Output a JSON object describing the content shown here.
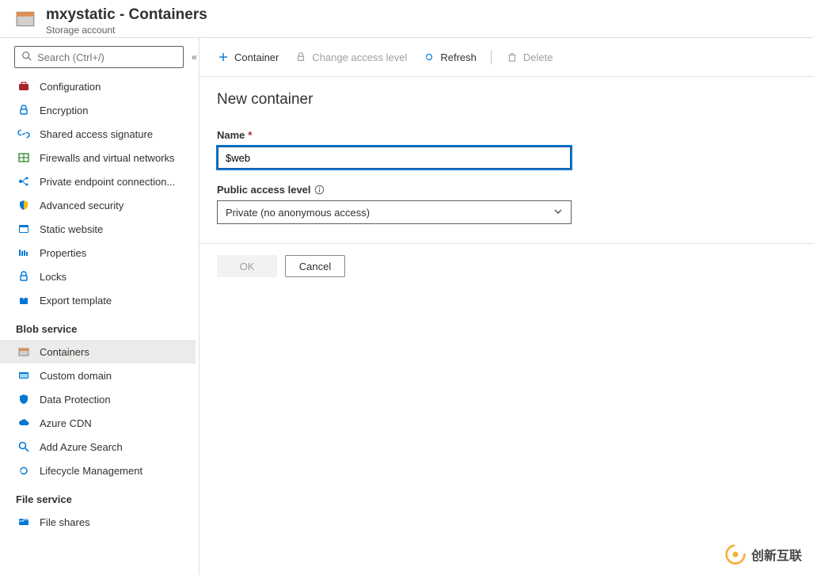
{
  "header": {
    "title": "mxystatic - Containers",
    "subtitle": "Storage account"
  },
  "search": {
    "placeholder": "Search (Ctrl+/)"
  },
  "sidebar": {
    "items_top": [
      {
        "label": "Configuration",
        "icon": "briefcase",
        "color": "#a4262c"
      },
      {
        "label": "Encryption",
        "icon": "lock",
        "color": "#0078d4"
      },
      {
        "label": "Shared access signature",
        "icon": "link",
        "color": "#0078d4"
      },
      {
        "label": "Firewalls and virtual networks",
        "icon": "firewall",
        "color": "#107c10"
      },
      {
        "label": "Private endpoint connection...",
        "icon": "endpoint",
        "color": "#0078d4"
      },
      {
        "label": "Advanced security",
        "icon": "shield",
        "color": "#0078d4"
      },
      {
        "label": "Static website",
        "icon": "website",
        "color": "#0078d4"
      },
      {
        "label": "Properties",
        "icon": "properties",
        "color": "#0078d4"
      },
      {
        "label": "Locks",
        "icon": "lock",
        "color": "#0078d4"
      },
      {
        "label": "Export template",
        "icon": "export",
        "color": "#0078d4"
      }
    ],
    "section_blob": "Blob service",
    "items_blob": [
      {
        "label": "Containers",
        "icon": "container",
        "color": "#0078d4",
        "active": true
      },
      {
        "label": "Custom domain",
        "icon": "domain",
        "color": "#0078d4"
      },
      {
        "label": "Data Protection",
        "icon": "protection",
        "color": "#0078d4"
      },
      {
        "label": "Azure CDN",
        "icon": "cloud",
        "color": "#0078d4"
      },
      {
        "label": "Add Azure Search",
        "icon": "search",
        "color": "#0078d4"
      },
      {
        "label": "Lifecycle Management",
        "icon": "lifecycle",
        "color": "#0078d4"
      }
    ],
    "section_file": "File service",
    "items_file": [
      {
        "label": "File shares",
        "icon": "fileshare",
        "color": "#0078d4"
      }
    ]
  },
  "toolbar": {
    "container": "Container",
    "change_access": "Change access level",
    "refresh": "Refresh",
    "delete": "Delete"
  },
  "form": {
    "heading": "New container",
    "name_label": "Name",
    "name_value": "$web",
    "access_label": "Public access level",
    "access_value": "Private (no anonymous access)",
    "ok": "OK",
    "cancel": "Cancel"
  },
  "watermark": {
    "text": "创新互联"
  }
}
